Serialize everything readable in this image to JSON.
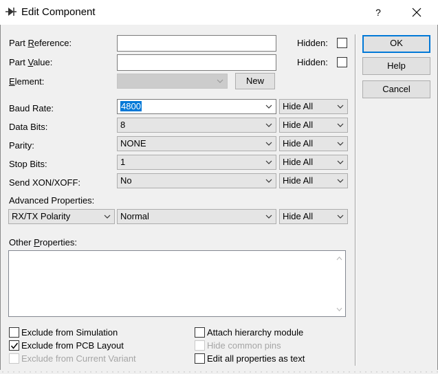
{
  "window": {
    "title": "Edit Component",
    "help_glyph": "?",
    "icon": "component-icon"
  },
  "part_reference": {
    "label_pre": "Part ",
    "label_u": "R",
    "label_post": "eference:",
    "value": "",
    "hidden_label": "Hidden:",
    "hidden_checked": false
  },
  "part_value": {
    "label_pre": "Part ",
    "label_u": "V",
    "label_post": "alue:",
    "value": "",
    "hidden_label": "Hidden:",
    "hidden_checked": false
  },
  "element": {
    "label_u": "E",
    "label_post": "lement:",
    "value": "",
    "new_button": "New"
  },
  "properties": [
    {
      "label": "Baud Rate:",
      "value": "4800",
      "visibility": "Hide All"
    },
    {
      "label": "Data Bits:",
      "value": "8",
      "visibility": "Hide All"
    },
    {
      "label": "Parity:",
      "value": "NONE",
      "visibility": "Hide All"
    },
    {
      "label": "Stop Bits:",
      "value": "1",
      "visibility": "Hide All"
    },
    {
      "label": "Send XON/XOFF:",
      "value": "No",
      "visibility": "Hide All"
    }
  ],
  "advanced": {
    "label": "Advanced Properties:",
    "property": "RX/TX Polarity",
    "value": "Normal",
    "visibility": "Hide All"
  },
  "other": {
    "label_pre": "Other ",
    "label_u": "P",
    "label_post": "roperties:",
    "value": ""
  },
  "checkboxes_left": [
    {
      "label": "Exclude from Simulation",
      "checked": false,
      "enabled": true
    },
    {
      "label": "Exclude from PCB Layout",
      "checked": true,
      "enabled": true
    },
    {
      "label": "Exclude from Current Variant",
      "checked": false,
      "enabled": false
    }
  ],
  "checkboxes_right": [
    {
      "label": "Attach hierarchy module",
      "checked": false,
      "enabled": true
    },
    {
      "label": "Hide common pins",
      "checked": false,
      "enabled": false
    },
    {
      "label": "Edit all properties as text",
      "checked": false,
      "enabled": true
    }
  ],
  "buttons": {
    "ok": "OK",
    "help": "Help",
    "cancel": "Cancel"
  },
  "colors": {
    "accent": "#0078d7",
    "dialog_bg": "#f0f0f0"
  }
}
